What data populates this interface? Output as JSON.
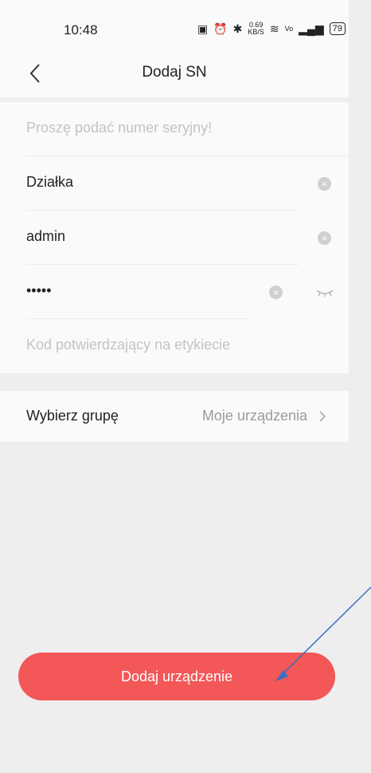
{
  "status_bar": {
    "time": "10:48",
    "speed_value": "0.69",
    "speed_unit": "KB/S",
    "battery": "79"
  },
  "header": {
    "title": "Dodaj SN"
  },
  "form": {
    "serial_placeholder": "Proszę podać numer seryjny!",
    "name_value": "Działka",
    "user_value": "admin",
    "password_value": "•••••",
    "code_placeholder": "Kod potwierdzający na etykiecie"
  },
  "group": {
    "label": "Wybierz grupę",
    "value": "Moje urządzenia"
  },
  "actions": {
    "add_label": "Dodaj urządzenie"
  },
  "colors": {
    "accent": "#f35757",
    "background": "#eeeeee",
    "card": "#fafafa"
  }
}
